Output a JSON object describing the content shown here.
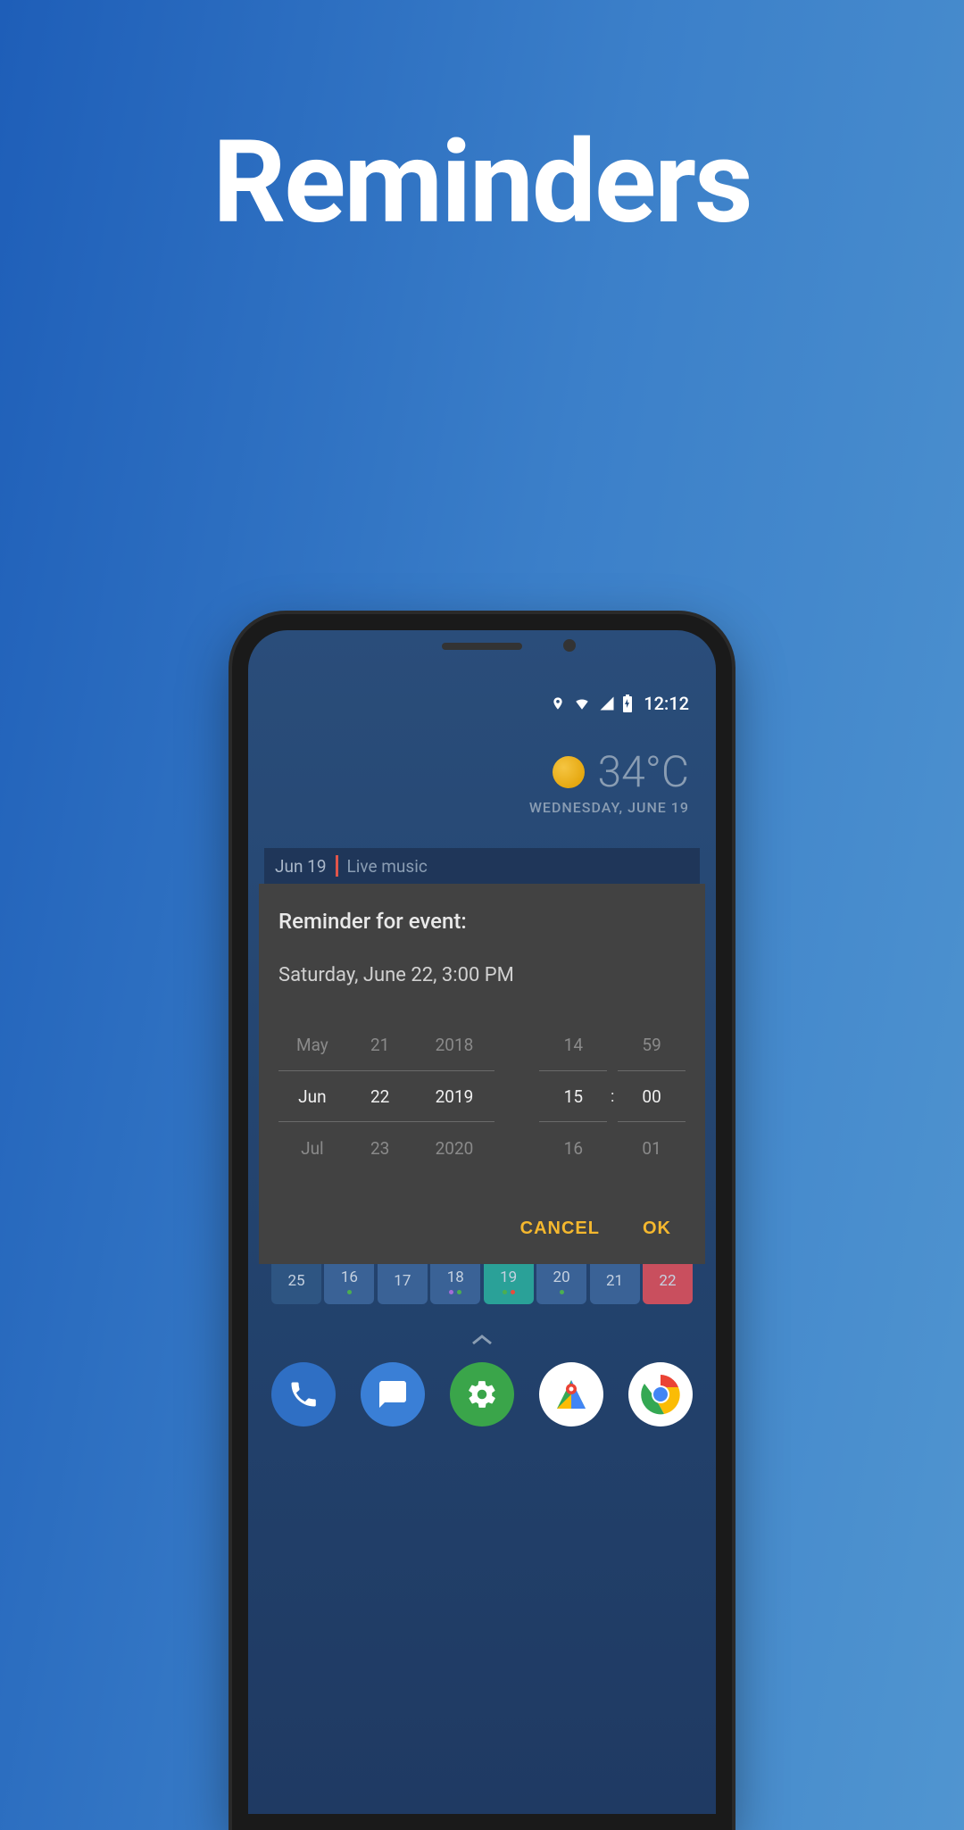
{
  "page_title": "Reminders",
  "status_bar": {
    "time": "12:12"
  },
  "weather": {
    "temp": "34°C",
    "date": "WEDNESDAY, JUNE 19"
  },
  "event_bar": {
    "date": "Jun 19",
    "title": "Live music"
  },
  "dialog": {
    "title": "Reminder for event:",
    "subtitle": "Saturday, June 22, 3:00 PM",
    "picker": {
      "month": {
        "prev": "May",
        "sel": "Jun",
        "next": "Jul"
      },
      "day": {
        "prev": "21",
        "sel": "22",
        "next": "23"
      },
      "year": {
        "prev": "2018",
        "sel": "2019",
        "next": "2020"
      },
      "hour": {
        "prev": "14",
        "sel": "15",
        "next": "16"
      },
      "min": {
        "prev": "59",
        "sel": "00",
        "next": "01"
      }
    },
    "cancel_label": "CANCEL",
    "ok_label": "OK"
  },
  "calendar_row": [
    {
      "day": "25",
      "bg": "#2e5582"
    },
    {
      "day": "16",
      "bg": "#3a6296",
      "dots": [
        "#4caf50"
      ]
    },
    {
      "day": "17",
      "bg": "#3a6296"
    },
    {
      "day": "18",
      "bg": "#3a6296",
      "dots": [
        "#a56cd6",
        "#4caf50"
      ]
    },
    {
      "day": "19",
      "bg": "#2aa198",
      "dots": [
        "#4caf50",
        "#e74c3c"
      ]
    },
    {
      "day": "20",
      "bg": "#3a6296",
      "dots": [
        "#4caf50"
      ]
    },
    {
      "day": "21",
      "bg": "#3a6296"
    },
    {
      "day": "22",
      "bg": "#c94f5e"
    }
  ],
  "dock": [
    {
      "name": "phone",
      "bg": "#2f6fc4"
    },
    {
      "name": "messages",
      "bg": "#3a7fd6"
    },
    {
      "name": "settings",
      "bg": "#3aa54a"
    },
    {
      "name": "maps",
      "bg": "#ffffff"
    },
    {
      "name": "chrome",
      "bg": "#ffffff"
    }
  ]
}
